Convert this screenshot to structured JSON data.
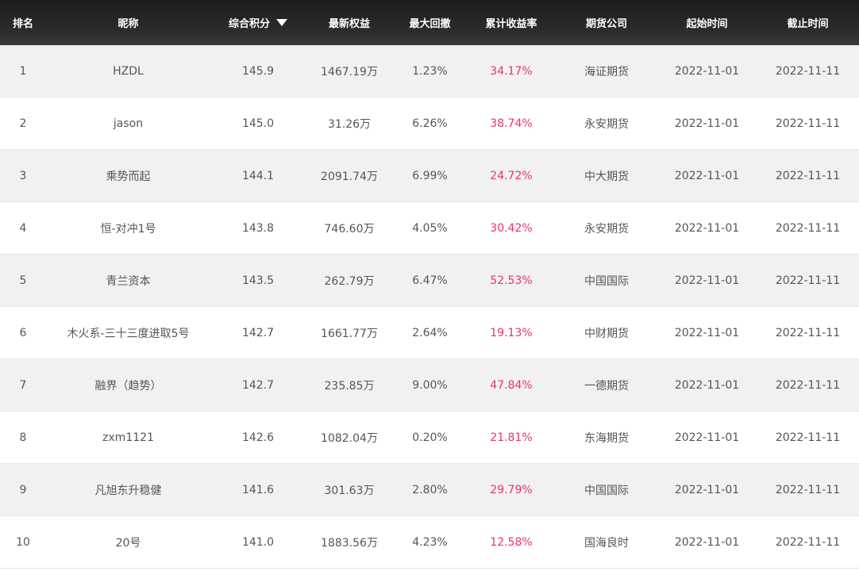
{
  "headers": {
    "rank": "排名",
    "nickname": "昵称",
    "score": "综合积分",
    "equity": "最新权益",
    "drawdown": "最大回撤",
    "return": "累计收益率",
    "company": "期货公司",
    "start": "起始时间",
    "end": "截止时间"
  },
  "sort_icon": "sort-desc-triangle-icon",
  "accent_color": "#e8336d",
  "rows": [
    {
      "rank": "1",
      "nickname": "HZDL",
      "score": "145.9",
      "equity": "1467.19万",
      "drawdown": "1.23%",
      "return": "34.17%",
      "company": "海证期货",
      "start": "2022-11-01",
      "end": "2022-11-11"
    },
    {
      "rank": "2",
      "nickname": "jason",
      "score": "145.0",
      "equity": "31.26万",
      "drawdown": "6.26%",
      "return": "38.74%",
      "company": "永安期货",
      "start": "2022-11-01",
      "end": "2022-11-11"
    },
    {
      "rank": "3",
      "nickname": "乘势而起",
      "score": "144.1",
      "equity": "2091.74万",
      "drawdown": "6.99%",
      "return": "24.72%",
      "company": "中大期货",
      "start": "2022-11-01",
      "end": "2022-11-11"
    },
    {
      "rank": "4",
      "nickname": "恒-对冲1号",
      "score": "143.8",
      "equity": "746.60万",
      "drawdown": "4.05%",
      "return": "30.42%",
      "company": "永安期货",
      "start": "2022-11-01",
      "end": "2022-11-11"
    },
    {
      "rank": "5",
      "nickname": "青兰资本",
      "score": "143.5",
      "equity": "262.79万",
      "drawdown": "6.47%",
      "return": "52.53%",
      "company": "中国国际",
      "start": "2022-11-01",
      "end": "2022-11-11"
    },
    {
      "rank": "6",
      "nickname": "木火系-三十三度进取5号",
      "score": "142.7",
      "equity": "1661.77万",
      "drawdown": "2.64%",
      "return": "19.13%",
      "company": "中财期货",
      "start": "2022-11-01",
      "end": "2022-11-11"
    },
    {
      "rank": "7",
      "nickname": "融界（趋势）",
      "score": "142.7",
      "equity": "235.85万",
      "drawdown": "9.00%",
      "return": "47.84%",
      "company": "一德期货",
      "start": "2022-11-01",
      "end": "2022-11-11"
    },
    {
      "rank": "8",
      "nickname": "zxm1121",
      "score": "142.6",
      "equity": "1082.04万",
      "drawdown": "0.20%",
      "return": "21.81%",
      "company": "东海期货",
      "start": "2022-11-01",
      "end": "2022-11-11"
    },
    {
      "rank": "9",
      "nickname": "凡旭东升稳健",
      "score": "141.6",
      "equity": "301.63万",
      "drawdown": "2.80%",
      "return": "29.79%",
      "company": "中国国际",
      "start": "2022-11-01",
      "end": "2022-11-11"
    },
    {
      "rank": "10",
      "nickname": "20号",
      "score": "141.0",
      "equity": "1883.56万",
      "drawdown": "4.23%",
      "return": "12.58%",
      "company": "国海良时",
      "start": "2022-11-01",
      "end": "2022-11-11"
    }
  ]
}
